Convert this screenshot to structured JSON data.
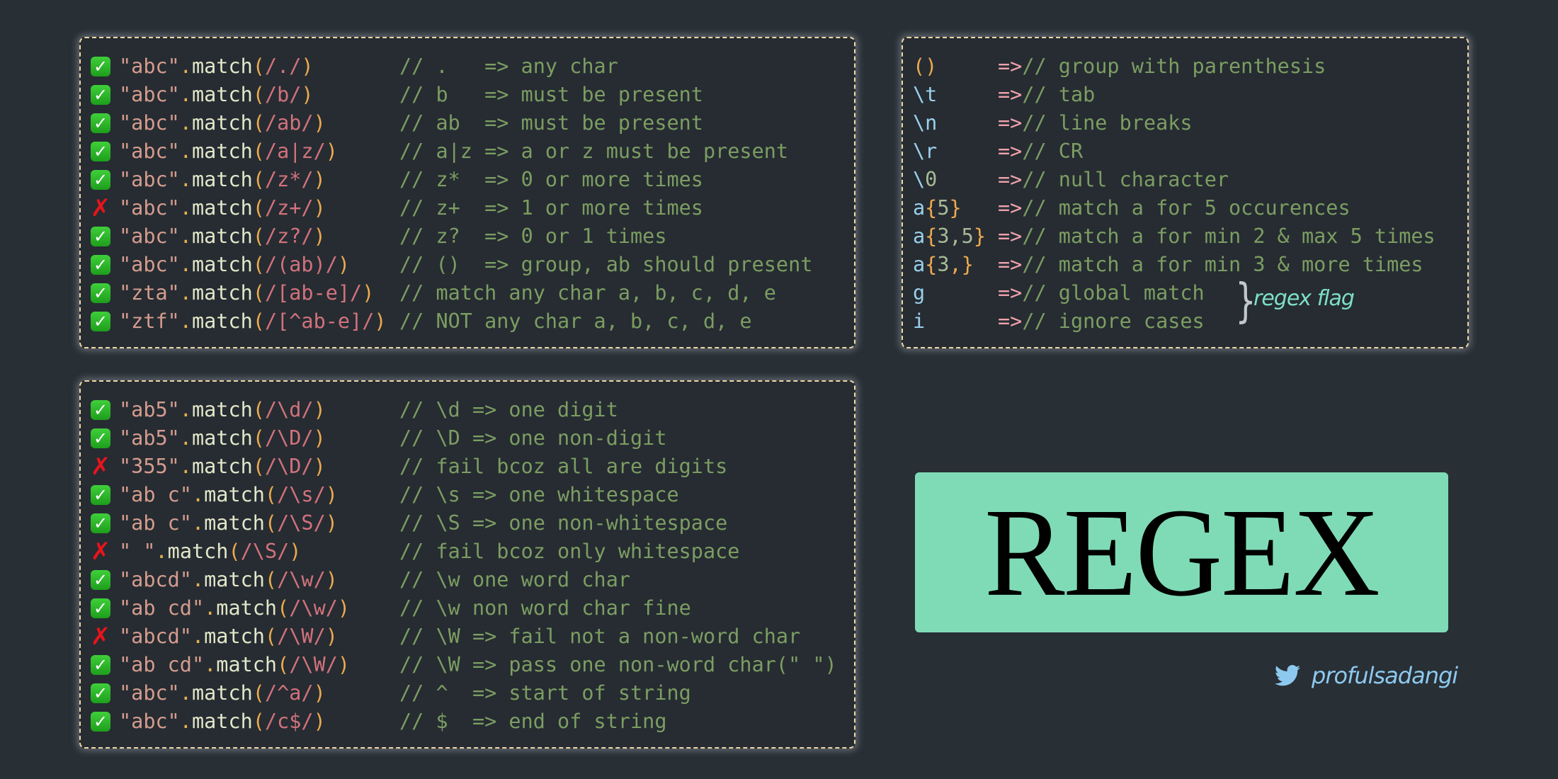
{
  "basic": [
    {
      "status": "pass",
      "str": "\"abc\"",
      "regex": "/./",
      "comment": "// .   => any char"
    },
    {
      "status": "pass",
      "str": "\"abc\"",
      "regex": "/b/",
      "comment": "// b   => must be present"
    },
    {
      "status": "pass",
      "str": "\"abc\"",
      "regex": "/ab/",
      "comment": "// ab  => must be present"
    },
    {
      "status": "pass",
      "str": "\"abc\"",
      "regex": "/a|z/",
      "comment": "// a|z => a or z must be present"
    },
    {
      "status": "pass",
      "str": "\"abc\"",
      "regex": "/z*/",
      "comment": "// z*  => 0 or more times"
    },
    {
      "status": "fail",
      "str": "\"abc\"",
      "regex": "/z+/",
      "comment": "// z+  => 1 or more times"
    },
    {
      "status": "pass",
      "str": "\"abc\"",
      "regex": "/z?/",
      "comment": "// z?  => 0 or 1 times"
    },
    {
      "status": "pass",
      "str": "\"abc\"",
      "regex": "/(ab)/",
      "comment": "// ()  => group, ab should present"
    },
    {
      "status": "pass",
      "str": "\"zta\"",
      "regex": "/[ab-e]/",
      "comment": "// match any char a, b, c, d, e"
    },
    {
      "status": "pass",
      "str": "\"ztf\"",
      "regex": "/[^ab-e]/",
      "comment": "// NOT any char a, b, c, d, e"
    }
  ],
  "special": [
    {
      "token_parts": [
        {
          "t": "()",
          "c": "brace"
        }
      ],
      "comment": "// group with parenthesis"
    },
    {
      "token_parts": [
        {
          "t": "\\t",
          "c": "esc"
        }
      ],
      "comment": "// tab"
    },
    {
      "token_parts": [
        {
          "t": "\\n",
          "c": "esc"
        }
      ],
      "comment": "// line breaks"
    },
    {
      "token_parts": [
        {
          "t": "\\r",
          "c": "esc"
        }
      ],
      "comment": "// CR"
    },
    {
      "token_parts": [
        {
          "t": "\\",
          "c": "esc"
        },
        {
          "t": "0",
          "c": "num"
        }
      ],
      "comment": "// null character"
    },
    {
      "token_parts": [
        {
          "t": "a",
          "c": "esc"
        },
        {
          "t": "{",
          "c": "brace"
        },
        {
          "t": "5",
          "c": "num"
        },
        {
          "t": "}",
          "c": "brace"
        }
      ],
      "comment": "// match a for 5 occurences"
    },
    {
      "token_parts": [
        {
          "t": "a",
          "c": "esc"
        },
        {
          "t": "{",
          "c": "brace"
        },
        {
          "t": "3,5",
          "c": "num"
        },
        {
          "t": "}",
          "c": "brace"
        }
      ],
      "comment": "// match a for min 2 & max 5 times"
    },
    {
      "token_parts": [
        {
          "t": "a",
          "c": "esc"
        },
        {
          "t": "{",
          "c": "brace"
        },
        {
          "t": "3",
          "c": "num"
        },
        {
          "t": ",",
          "c": "brace"
        },
        {
          "t": "}",
          "c": "brace"
        }
      ],
      "comment": "// match a for min 3 & more times"
    },
    {
      "token_parts": [
        {
          "t": "g",
          "c": "esc"
        }
      ],
      "comment": "// global match"
    },
    {
      "token_parts": [
        {
          "t": "i",
          "c": "esc"
        }
      ],
      "comment": "// ignore cases"
    }
  ],
  "special_arrow": "=>",
  "flag_note": "regex flag",
  "classes": [
    {
      "status": "pass",
      "str": "\"ab5\"",
      "regex": "/\\d/",
      "comment": "// \\d => one digit"
    },
    {
      "status": "pass",
      "str": "\"ab5\"",
      "regex": "/\\D/",
      "comment": "// \\D => one non-digit"
    },
    {
      "status": "fail",
      "str": "\"355\"",
      "regex": "/\\D/",
      "comment": "// fail bcoz all are digits"
    },
    {
      "status": "pass",
      "str": "\"ab c\"",
      "regex": "/\\s/",
      "comment": "// \\s => one whitespace"
    },
    {
      "status": "pass",
      "str": "\"ab c\"",
      "regex": "/\\S/",
      "comment": "// \\S => one non-whitespace"
    },
    {
      "status": "fail",
      "str": "\" \"",
      "regex": "/\\S/",
      "comment": "// fail bcoz only whitespace"
    },
    {
      "status": "pass",
      "str": "\"abcd\"",
      "regex": "/\\w/",
      "comment": "// \\w one word char"
    },
    {
      "status": "pass",
      "str": "\"ab cd\"",
      "regex": "/\\w/",
      "comment": "// \\w non word char fine"
    },
    {
      "status": "fail",
      "str": "\"abcd\"",
      "regex": "/\\W/",
      "comment": "// \\W => fail not a non-word char"
    },
    {
      "status": "pass",
      "str": "\"ab cd\"",
      "regex": "/\\W/",
      "comment": "// \\W => pass one non-word char(\" \")"
    },
    {
      "status": "pass",
      "str": "\"abc\"",
      "regex": "/^a/",
      "comment": "// ^  => start of string"
    },
    {
      "status": "pass",
      "str": "\"abc\"",
      "regex": "/c$/",
      "comment": "// $  => end of string"
    }
  ],
  "code": {
    "method_dot": ".",
    "method": "match",
    "open": "(",
    "close": ")"
  },
  "status_icons": {
    "pass": "✓",
    "fail": "✗"
  },
  "title": "REGEX",
  "author": {
    "icon": "twitter-bird-icon",
    "handle": "profulsadangi"
  },
  "colors": {
    "background": "#282f35",
    "border": "#f1d7a5",
    "title_card": "#7fdbb6",
    "comment": "#7c9d62",
    "string": "#d59c8e",
    "regex": "#d2727c",
    "paren": "#eda94e",
    "escape": "#9ad0ec",
    "arrow": "#f0a2ab",
    "pass": "#2eb82b",
    "fail": "#e8141b",
    "handle": "#8dc9ef",
    "flag_note": "#7de0c4"
  }
}
